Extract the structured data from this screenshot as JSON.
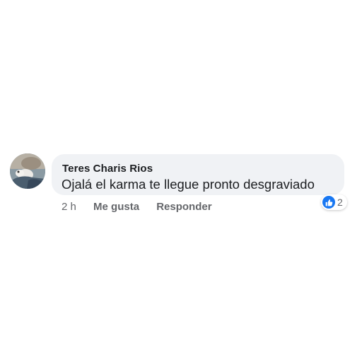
{
  "comment": {
    "author": "Teres Charis Rios",
    "text": "Ojalá el karma te llegue pronto desgraviado",
    "time": "2 h",
    "actions": {
      "like_label": "Me gusta",
      "reply_label": "Responder"
    },
    "reactions": {
      "icon": "like-icon",
      "count": "2"
    },
    "avatar": {
      "icon": "profile-photo"
    }
  },
  "colors": {
    "bubble_bg": "#f0f2f5",
    "text": "#1c1e21",
    "secondary_text": "#65676b",
    "like_blue": "#1877f2"
  }
}
